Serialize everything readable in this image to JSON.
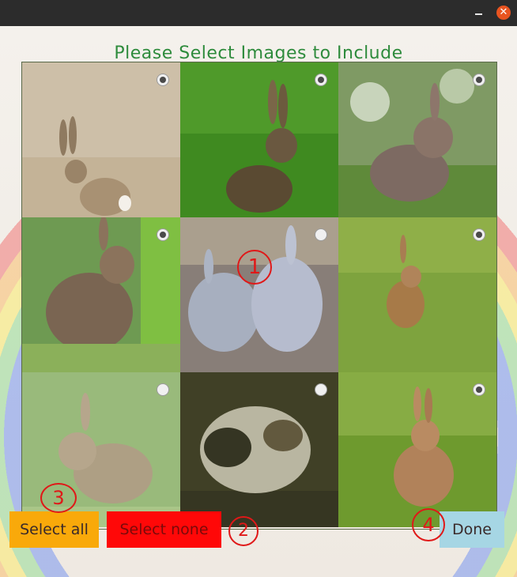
{
  "window": {
    "minimize_icon": "minimize-icon",
    "close_icon": "close-icon",
    "close_glyph": "✕"
  },
  "title": "Please Select Images to Include",
  "images": [
    {
      "name": "rabbit-sand",
      "selected": true
    },
    {
      "name": "rabbit-grass-dark",
      "selected": true
    },
    {
      "name": "rabbit-bush",
      "selected": true
    },
    {
      "name": "rabbit-reeds",
      "selected": true
    },
    {
      "name": "grey-rabbits",
      "selected": false
    },
    {
      "name": "rabbit-field",
      "selected": true
    },
    {
      "name": "rabbit-green",
      "selected": false
    },
    {
      "name": "spotted-rabbit",
      "selected": false
    },
    {
      "name": "rabbit-lawn",
      "selected": true
    }
  ],
  "buttons": {
    "select_all": "Select all",
    "select_none": "Select none",
    "done": "Done"
  },
  "annotations": [
    "1",
    "2",
    "3",
    "4"
  ],
  "colors": {
    "title": "#2e8b3c",
    "select_all_bg": "#f9a90a",
    "select_none_bg": "#ff0808",
    "done_bg": "#a6d6e4",
    "annotation": "#e01818"
  }
}
